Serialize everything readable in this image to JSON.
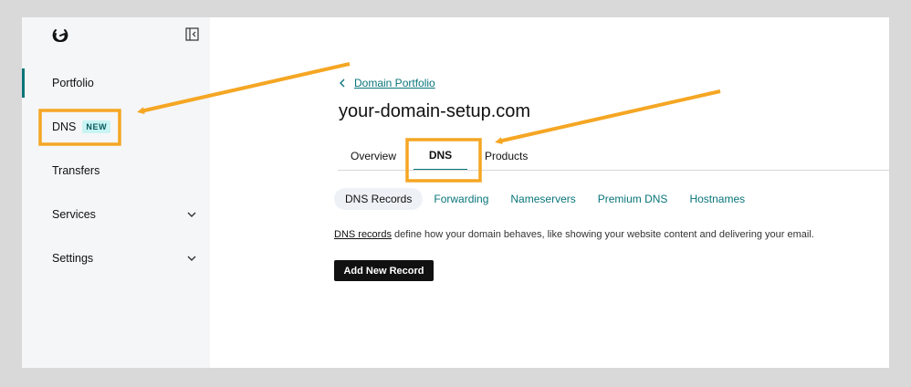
{
  "colors": {
    "accent": "#09757a",
    "highlight": "#f5a623",
    "badge_bg": "#c8f4f3"
  },
  "sidebar": {
    "logo_icon": "godaddy-logo-icon",
    "collapse_icon": "collapse-sidebar-icon",
    "items": [
      {
        "label": "Portfolio",
        "active": true
      },
      {
        "label": "DNS",
        "badge": "NEW"
      },
      {
        "label": "Transfers"
      },
      {
        "label": "Services",
        "icon": "chevron-down-icon"
      },
      {
        "label": "Settings",
        "icon": "chevron-down-icon"
      }
    ]
  },
  "main": {
    "breadcrumb": "Domain Portfolio",
    "title": "your-domain-setup.com",
    "tabs": [
      {
        "label": "Overview"
      },
      {
        "label": "DNS",
        "active": true
      },
      {
        "label": "Products"
      }
    ],
    "subtabs": [
      {
        "label": "DNS Records",
        "active": true
      },
      {
        "label": "Forwarding"
      },
      {
        "label": "Nameservers"
      },
      {
        "label": "Premium DNS"
      },
      {
        "label": "Hostnames"
      }
    ],
    "description_link": "DNS records",
    "description_text": " define how your domain behaves, like showing your website content and delivering your email.",
    "add_button": "Add New Record"
  }
}
